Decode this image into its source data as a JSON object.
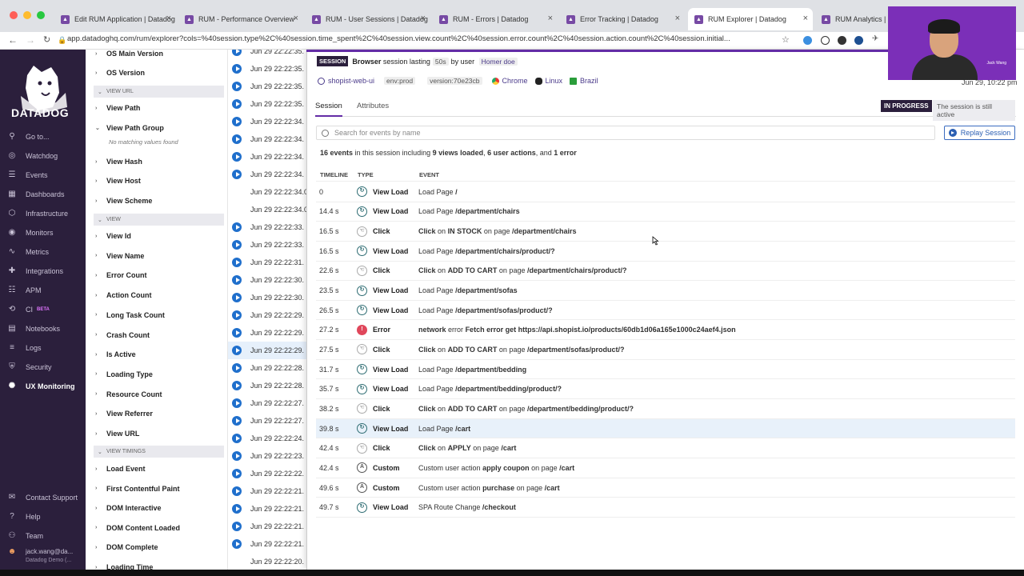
{
  "browser": {
    "tabs": [
      {
        "title": "Edit RUM Application | Datadog"
      },
      {
        "title": "RUM - Performance Overview"
      },
      {
        "title": "RUM - User Sessions | Datadog"
      },
      {
        "title": "RUM - Errors | Datadog"
      },
      {
        "title": "Error Tracking | Datadog"
      },
      {
        "title": "RUM Explorer | Datadog"
      },
      {
        "title": "RUM Analytics | D"
      }
    ],
    "url": "app.datadoghq.com/rum/explorer?cols=%40session.type%2C%40session.time_spent%2C%40session.view.count%2C%40session.error.count%2C%40session.action.count%2C%40session.initial..."
  },
  "nav": {
    "brand": "DATADOG",
    "items": [
      {
        "label": "Go to...",
        "icon": "search-icon"
      },
      {
        "label": "Watchdog",
        "icon": "binoculars-icon"
      },
      {
        "label": "Events",
        "icon": "events-icon"
      },
      {
        "label": "Dashboards",
        "icon": "dashboard-icon"
      },
      {
        "label": "Infrastructure",
        "icon": "infrastructure-icon"
      },
      {
        "label": "Monitors",
        "icon": "monitor-icon"
      },
      {
        "label": "Metrics",
        "icon": "metrics-icon"
      },
      {
        "label": "Integrations",
        "icon": "puzzle-icon"
      },
      {
        "label": "APM",
        "icon": "apm-icon"
      },
      {
        "label": "CI",
        "icon": "ci-icon",
        "badge": "BETA"
      },
      {
        "label": "Notebooks",
        "icon": "notebook-icon"
      },
      {
        "label": "Logs",
        "icon": "logs-icon"
      },
      {
        "label": "Security",
        "icon": "shield-icon"
      },
      {
        "label": "UX Monitoring",
        "icon": "ux-icon"
      }
    ],
    "bottom": [
      {
        "label": "Contact Support",
        "icon": "chat-icon"
      },
      {
        "label": "Help",
        "icon": "help-icon"
      },
      {
        "label": "Team",
        "icon": "team-icon"
      }
    ],
    "user": {
      "name": "jack.wang@da...",
      "org": "Datadog Demo (..."
    }
  },
  "facets": {
    "items_top": [
      "OS Main Version",
      "OS Version"
    ],
    "group_view_url": "VIEW URL",
    "view_url_items": [
      "View Path",
      "View Path Group",
      "View Hash",
      "View Host",
      "View Scheme"
    ],
    "no_values": "No matching values found",
    "group_view": "VIEW",
    "view_items": [
      "View Id",
      "View Name",
      "Error Count",
      "Action Count",
      "Long Task Count",
      "Crash Count",
      "Is Active",
      "Loading Type",
      "Resource Count",
      "View Referrer",
      "View URL"
    ],
    "group_timings": "VIEW TIMINGS",
    "timing_items": [
      "Load Event",
      "First Contentful Paint",
      "DOM Interactive",
      "DOM Content Loaded",
      "DOM Complete",
      "Loading Time"
    ]
  },
  "session_list": [
    "Jun 29 22:22:35.",
    "Jun 29 22:22:35.",
    "Jun 29 22:22:35.",
    "Jun 29 22:22:35.",
    "Jun 29 22:22:34.",
    "Jun 29 22:22:34.",
    "Jun 29 22:22:34.",
    "Jun 29 22:22:34.",
    "Jun 29 22:22:34.0",
    "Jun 29 22:22:34.0",
    "Jun 29 22:22:33.",
    "Jun 29 22:22:33.",
    "Jun 29 22:22:31.",
    "Jun 29 22:22:30.",
    "Jun 29 22:22:30.",
    "Jun 29 22:22:29.",
    "Jun 29 22:22:29.",
    "Jun 29 22:22:29.",
    "Jun 29 22:22:28.",
    "Jun 29 22:22:28.",
    "Jun 29 22:22:27.",
    "Jun 29 22:22:27.",
    "Jun 29 22:22:24.",
    "Jun 29 22:22:23.",
    "Jun 29 22:22:22.",
    "Jun 29 22:22:21.",
    "Jun 29 22:22:21.",
    "Jun 29 22:22:21.",
    "Jun 29 22:22:21.",
    "Jun 29 22:22:20."
  ],
  "session": {
    "badge": "SESSION",
    "type": "Browser",
    "lasting_text": "session lasting",
    "duration": "50s",
    "by_user": "by user",
    "user": "Homer doe",
    "service": "shopist-web-ui",
    "env": "env:prod",
    "version": "version:70e23cb",
    "browser": "Chrome",
    "os": "Linux",
    "country": "Brazil",
    "datetime": "Jun 29, 10:22 pm",
    "tabs": [
      "Session",
      "Attributes"
    ],
    "status_badge": "IN PROGRESS",
    "status_text": "The session is still active",
    "search_placeholder": "Search for events by name",
    "replay_label": "Replay Session",
    "summary": {
      "count": "16 events",
      "mid": "in this session including",
      "views": "9 views loaded",
      "actions": "6 user actions",
      "and": "and",
      "errors": "1 error"
    },
    "columns": [
      "TIMELINE",
      "TYPE",
      "EVENT"
    ]
  },
  "events": [
    {
      "t": "0",
      "type": "View Load",
      "kind": "view",
      "pre": "Load Page",
      "b1": "/",
      "mid": "",
      "b2": ""
    },
    {
      "t": "14.4 s",
      "type": "View Load",
      "kind": "view",
      "pre": "Load Page",
      "b1": "/department/chairs",
      "mid": "",
      "b2": ""
    },
    {
      "t": "16.5 s",
      "type": "Click",
      "kind": "click",
      "pre": "Click",
      "b1": "on",
      "mid": "IN STOCK",
      "b2": "on page",
      "b3": "/department/chairs"
    },
    {
      "t": "16.5 s",
      "type": "View Load",
      "kind": "view",
      "pre": "Load Page",
      "b1": "/department/chairs/product/?",
      "mid": "",
      "b2": ""
    },
    {
      "t": "22.6 s",
      "type": "Click",
      "kind": "click",
      "pre": "Click",
      "b1": "on",
      "mid": "ADD TO CART",
      "b2": "on page",
      "b3": "/department/chairs/product/?"
    },
    {
      "t": "23.5 s",
      "type": "View Load",
      "kind": "view",
      "pre": "Load Page",
      "b1": "/department/sofas",
      "mid": "",
      "b2": ""
    },
    {
      "t": "26.5 s",
      "type": "View Load",
      "kind": "view",
      "pre": "Load Page",
      "b1": "/department/sofas/product/?",
      "mid": "",
      "b2": ""
    },
    {
      "t": "27.2 s",
      "type": "Error",
      "kind": "error",
      "pre": "network",
      "b1": "error",
      "mid": "Fetch error get https://api.shopist.io/products/60db1d06a165e1000c24aef4.json",
      "b2": ""
    },
    {
      "t": "27.5 s",
      "type": "Click",
      "kind": "click",
      "pre": "Click",
      "b1": "on",
      "mid": "ADD TO CART",
      "b2": "on page",
      "b3": "/department/sofas/product/?"
    },
    {
      "t": "31.7 s",
      "type": "View Load",
      "kind": "view",
      "pre": "Load Page",
      "b1": "/department/bedding",
      "mid": "",
      "b2": ""
    },
    {
      "t": "35.7 s",
      "type": "View Load",
      "kind": "view",
      "pre": "Load Page",
      "b1": "/department/bedding/product/?",
      "mid": "",
      "b2": ""
    },
    {
      "t": "38.2 s",
      "type": "Click",
      "kind": "click",
      "pre": "Click",
      "b1": "on",
      "mid": "ADD TO CART",
      "b2": "on page",
      "b3": "/department/bedding/product/?"
    },
    {
      "t": "39.8 s",
      "type": "View Load",
      "kind": "view",
      "pre": "Load Page",
      "b1": "/cart",
      "mid": "",
      "b2": ""
    },
    {
      "t": "42.4 s",
      "type": "Click",
      "kind": "click",
      "pre": "Click",
      "b1": "on",
      "mid": "APPLY",
      "b2": "on page",
      "b3": "/cart"
    },
    {
      "t": "42.4 s",
      "type": "Custom",
      "kind": "custom",
      "pre": "Custom user action",
      "b1": "apply coupon",
      "mid": "",
      "b2": "on page",
      "b3": "/cart"
    },
    {
      "t": "49.6 s",
      "type": "Custom",
      "kind": "custom",
      "pre": "Custom user action",
      "b1": "purchase",
      "mid": "",
      "b2": "on page",
      "b3": "/cart"
    },
    {
      "t": "49.7 s",
      "type": "View Load",
      "kind": "view",
      "pre": "SPA Route Change",
      "b1": "/checkout",
      "mid": "",
      "b2": ""
    }
  ],
  "video": {
    "name": "Jack Wang"
  },
  "colors": {
    "nav_bg": "#2b1f3c",
    "accent": "#632ca6",
    "link_blue": "#2b5fb3",
    "error": "#e0475b"
  }
}
